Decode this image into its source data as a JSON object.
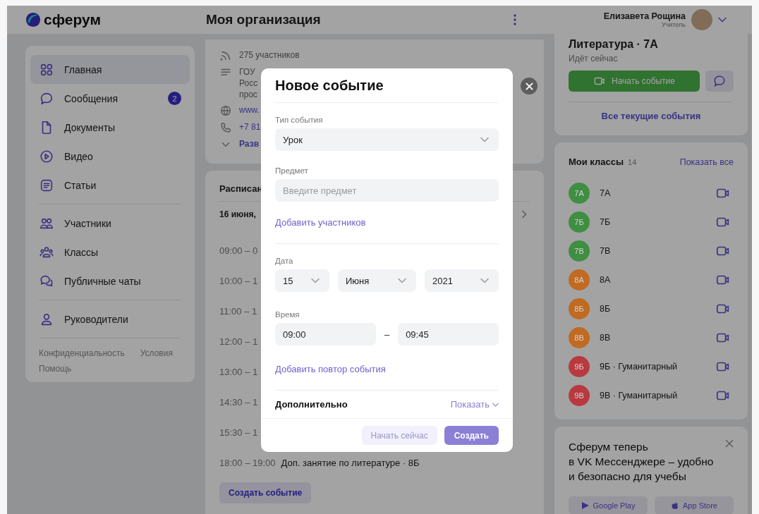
{
  "header": {
    "logo": "сферум",
    "title": "Моя организация",
    "user_name": "Елизавета Рощина",
    "user_role": "Учитель"
  },
  "sidebar": {
    "groups": [
      {
        "items": [
          {
            "label": "Главная",
            "selected": true
          },
          {
            "label": "Сообщения",
            "badge": "2",
            "selected": false
          },
          {
            "label": "Документы",
            "selected": false
          },
          {
            "label": "Видео",
            "selected": false
          },
          {
            "label": "Статьи",
            "selected": false
          }
        ]
      },
      {
        "items": [
          {
            "label": "Участники",
            "selected": false
          },
          {
            "label": "Классы",
            "selected": false
          },
          {
            "label": "Публичные чаты",
            "selected": false
          }
        ]
      },
      {
        "items": [
          {
            "label": "Руководители",
            "selected": false
          }
        ]
      }
    ],
    "footer_links": [
      "Конфиденциальность",
      "Условия",
      "Помощь"
    ]
  },
  "organization": {
    "rows": [
      {
        "kind": "members",
        "text": "275 участников"
      },
      {
        "kind": "description",
        "lines": [
          "ГОУ",
          "Росс",
          "прос"
        ]
      },
      {
        "kind": "website",
        "text": "www."
      },
      {
        "kind": "phone",
        "text": "+7 81"
      },
      {
        "kind": "expand",
        "text": "Разв"
      }
    ]
  },
  "schedule": {
    "title": "Расписан",
    "date": "16 июня,",
    "rows": [
      {
        "time": "09:00 – 0"
      },
      {
        "time": "10:00 – 1"
      },
      {
        "time": "11:00 – 1"
      },
      {
        "time": "12:00 – 1"
      },
      {
        "time": "13:00 – 1"
      },
      {
        "time": "14:30 – 1"
      },
      {
        "time": "15:30 – 1"
      },
      {
        "time": "18:00 – 19:00",
        "title": "Доп. занятие по литературе · 8Б"
      }
    ],
    "create_button": "Создать событие"
  },
  "current_event": {
    "title": "Литература · 7А",
    "status": "Идёт сейчас",
    "start_button": "Начать событие",
    "all_link": "Все текущие события"
  },
  "classes": {
    "title": "Мои классы",
    "count": "14",
    "show_all": "Показать все",
    "items": [
      {
        "badge": "7А",
        "name": "7А",
        "color": "#3f8e42"
      },
      {
        "badge": "7Б",
        "name": "7Б",
        "color": "#3f8e42"
      },
      {
        "badge": "7В",
        "name": "7В",
        "color": "#3f8e42"
      },
      {
        "badge": "8А",
        "name": "8А",
        "color": "#c06a22"
      },
      {
        "badge": "8Б",
        "name": "8Б",
        "color": "#c06a22"
      },
      {
        "badge": "8В",
        "name": "8В",
        "color": "#c06a22"
      },
      {
        "badge": "9Б",
        "name": "9Б · Гуманитарный",
        "color": "#b83a3e"
      },
      {
        "badge": "9В",
        "name": "9В · Гуманитарный",
        "color": "#b83a3e"
      }
    ]
  },
  "promo": {
    "lines": [
      "Сферум теперь",
      "в VK Мессенджере – удобно",
      "и безопасно для учебы"
    ],
    "buttons": [
      {
        "label": "Google Play",
        "kind": "google"
      },
      {
        "label": "App Store",
        "kind": "apple"
      }
    ]
  },
  "modal": {
    "title": "Новое событие",
    "type_label": "Тип события",
    "type_value": "Урок",
    "subject_label": "Предмет",
    "subject_placeholder": "Введите предмет",
    "add_participants": "Добавить участников",
    "date_label": "Дата",
    "date": [
      "15",
      "Июня",
      "2021"
    ],
    "time_label": "Время",
    "time_start": "09:00",
    "time_separator": "–",
    "time_end": "09:45",
    "add_repeat": "Добавить повтор события",
    "extra_label": "Дополнительно",
    "extra_toggle": "Показать",
    "secondary_button": "Начать сейчас",
    "primary_button": "Создать"
  }
}
